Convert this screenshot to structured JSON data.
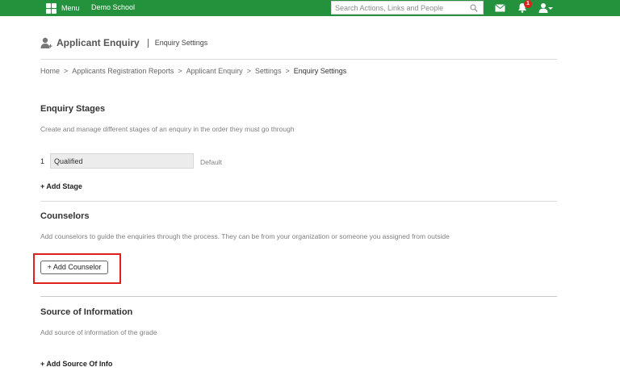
{
  "topbar": {
    "menu_label": "Menu",
    "school_name": "Demo School",
    "search_placeholder": "Search Actions, Links and People",
    "notification_count": "1",
    "bar_color": "#24913d"
  },
  "header": {
    "title": "Applicant Enquiry",
    "subtitle": "Enquiry Settings"
  },
  "breadcrumb": {
    "items": [
      "Home",
      "Applicants Registration Reports",
      "Applicant Enquiry",
      "Settings",
      "Enquiry Settings"
    ],
    "separator": ">"
  },
  "stages": {
    "title": "Enquiry Stages",
    "description": "Create and manage different stages of an enquiry in the order they must go through",
    "items": [
      {
        "number": "1",
        "value": "Qualified",
        "tag": "Default"
      }
    ],
    "add_label": "+ Add Stage"
  },
  "counselors": {
    "title": "Counselors",
    "description": "Add counselors to guide the enquiries through the process. They can be from your organization or someone you assigned from outside",
    "add_label": "+ Add Counselor",
    "highlight_color": "#e0201f"
  },
  "source": {
    "title": "Source of Information",
    "description": "Add source of information of the grade",
    "add_label": "+ Add Source Of Info"
  }
}
